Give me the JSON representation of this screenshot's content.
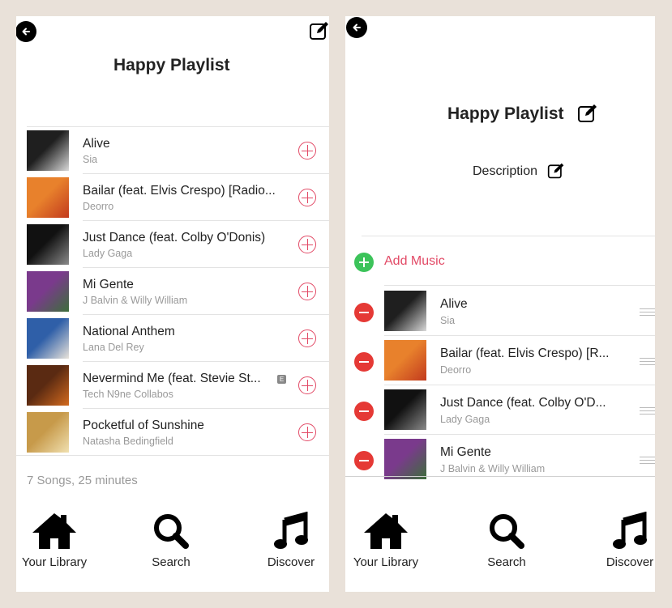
{
  "left_screen": {
    "title": "Happy Playlist",
    "songs": [
      {
        "title": "Alive",
        "artist": "Sia",
        "colors": [
          "#1f1f1f",
          "#d9d9d9"
        ]
      },
      {
        "title": "Bailar (feat. Elvis Crespo) [Radio...",
        "artist": "Deorro",
        "colors": [
          "#e8812c",
          "#c23a1e"
        ]
      },
      {
        "title": "Just Dance (feat. Colby O'Donis)",
        "artist": "Lady Gaga",
        "colors": [
          "#111111",
          "#8a8a8a"
        ]
      },
      {
        "title": "Mi Gente",
        "artist": "J Balvin & Willy William",
        "colors": [
          "#7a3a8c",
          "#3c6e3a"
        ]
      },
      {
        "title": "National Anthem",
        "artist": "Lana Del Rey",
        "colors": [
          "#2f5fa8",
          "#e9e3da"
        ]
      },
      {
        "title": "Nevermind Me (feat. Stevie St...",
        "artist": "Tech N9ne Collabos",
        "explicit": "E",
        "colors": [
          "#5a2a12",
          "#d36a1e"
        ]
      },
      {
        "title": "Pocketful of Sunshine",
        "artist": "Natasha Bedingfield",
        "colors": [
          "#c79a4a",
          "#f0e0b0"
        ]
      }
    ],
    "summary": "7 Songs, 25 minutes"
  },
  "right_screen": {
    "title": "Happy Playlist",
    "description_label": "Description",
    "add_music_label": "Add Music",
    "songs": [
      {
        "title": "Alive",
        "artist": "Sia",
        "colors": [
          "#1f1f1f",
          "#d9d9d9"
        ]
      },
      {
        "title": "Bailar (feat. Elvis Crespo) [R...",
        "artist": "Deorro",
        "colors": [
          "#e8812c",
          "#c23a1e"
        ]
      },
      {
        "title": "Just Dance (feat. Colby O'D...",
        "artist": "Lady Gaga",
        "colors": [
          "#111111",
          "#8a8a8a"
        ]
      },
      {
        "title": "Mi Gente",
        "artist": "J Balvin & Willy William",
        "colors": [
          "#7a3a8c",
          "#3c6e3a"
        ]
      }
    ]
  },
  "tabbar": {
    "items": [
      {
        "label": "Your Library",
        "icon": "home-icon"
      },
      {
        "label": "Search",
        "icon": "search-icon"
      },
      {
        "label": "Discover",
        "icon": "music-note-icon"
      }
    ]
  },
  "colors": {
    "background": "#e9e1d9",
    "accent": "#e24a66",
    "add_green": "#3cc35a",
    "remove_red": "#e53935"
  }
}
